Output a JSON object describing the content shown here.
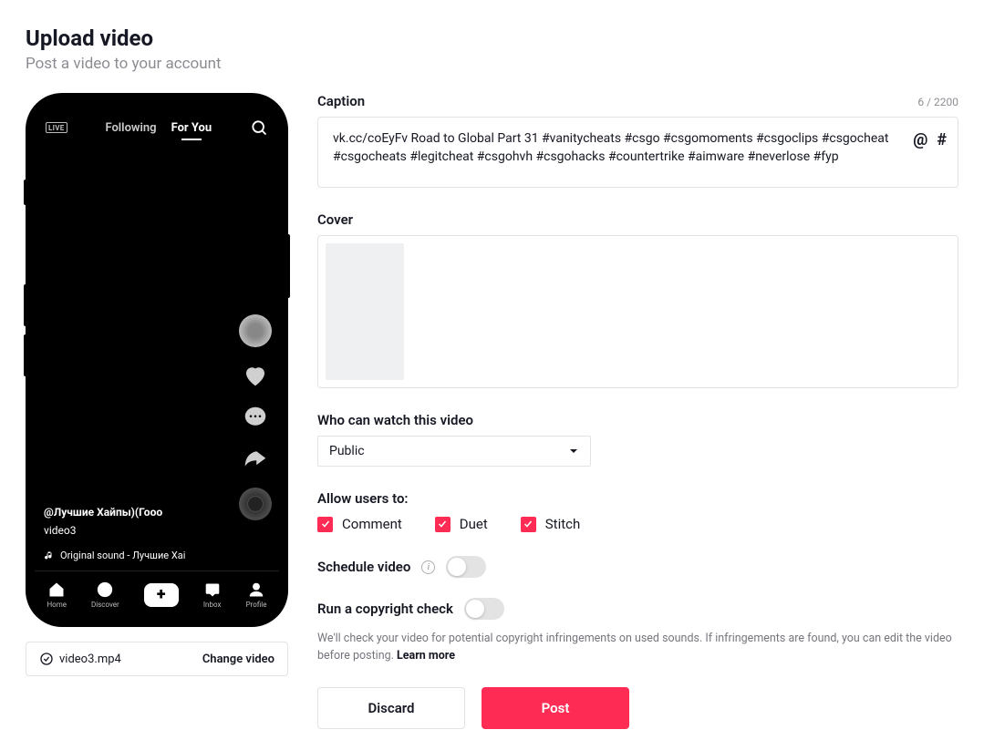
{
  "header": {
    "title": "Upload video",
    "subtitle": "Post a video to your account"
  },
  "preview": {
    "liveLabel": "LIVE",
    "tabs": {
      "following": "Following",
      "forYou": "For You"
    },
    "user": "@Лучшие Хайпы)(Гооо",
    "videoName": "video3",
    "sound": "Original sound - Лучшие Хаі",
    "nav": {
      "home": "Home",
      "discover": "Discover",
      "inbox": "Inbox",
      "profile": "Profile"
    }
  },
  "file": {
    "name": "video3.mp4",
    "changeLabel": "Change video"
  },
  "caption": {
    "label": "Caption",
    "counter": "6 / 2200",
    "text": "vk.cc/coEyFv Road to Global Part 31 #vanitycheats #csgo #csgomoments #csgoclips #csgocheat #csgocheats #legitcheat #csgohvh #csgohacks #countertrike #aimware #neverlose #fyp"
  },
  "cover": {
    "label": "Cover"
  },
  "privacy": {
    "label": "Who can watch this video",
    "value": "Public"
  },
  "allow": {
    "label": "Allow users to:",
    "options": {
      "comment": "Comment",
      "duet": "Duet",
      "stitch": "Stitch"
    }
  },
  "schedule": {
    "label": "Schedule video"
  },
  "copyright": {
    "label": "Run a copyright check",
    "helper": "We'll check your video for potential copyright infringements on used sounds. If infringements are found, you can edit the video before posting. ",
    "learnMore": "Learn more"
  },
  "buttons": {
    "discard": "Discard",
    "post": "Post"
  }
}
